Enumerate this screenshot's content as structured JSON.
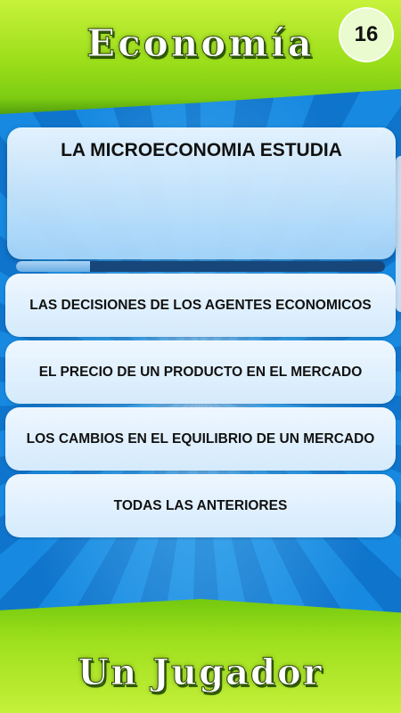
{
  "header": {
    "title": "Economía",
    "question_number": "16"
  },
  "question": {
    "text": "LA MICROECONOMIA ESTUDIA",
    "time_remaining_fraction": 0.2
  },
  "answers": [
    {
      "label": "LAS DECISIONES DE LOS AGENTES ECONOMICOS"
    },
    {
      "label": "EL PRECIO DE UN PRODUCTO EN EL MERCADO"
    },
    {
      "label": "LOS CAMBIOS EN EL EQUILIBRIO DE UN MERCADO"
    },
    {
      "label": "TODAS LAS ANTERIORES"
    }
  ],
  "footer": {
    "mode_label": "Un Jugador"
  },
  "colors": {
    "banner_green": "#9bde1a",
    "background_blue": "#1678d2",
    "timer_track": "#17467a",
    "timer_fill": "#6aaee4"
  }
}
